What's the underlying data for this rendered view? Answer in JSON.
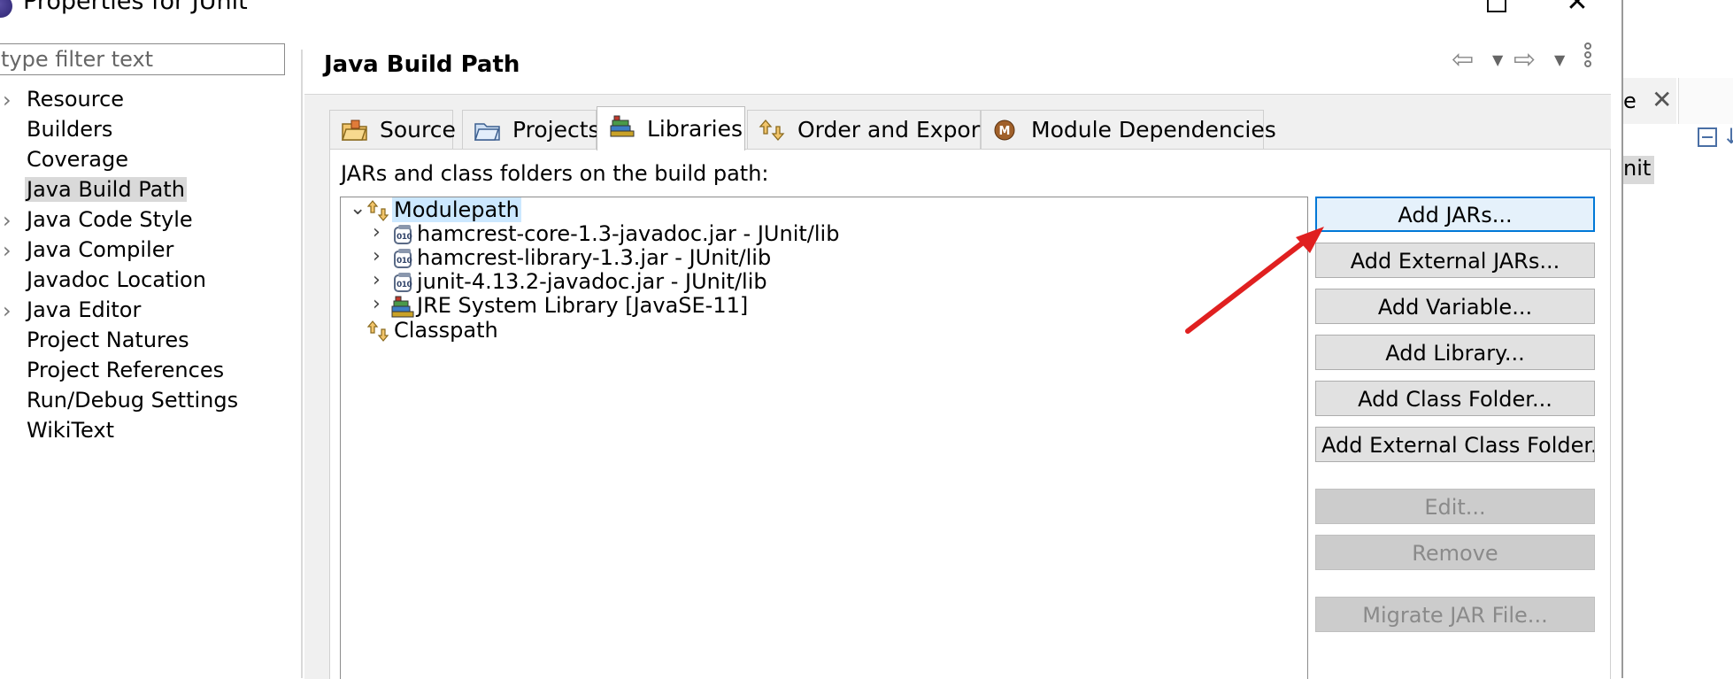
{
  "window": {
    "title": "Properties for JUnit",
    "minimize_label": "",
    "close_glyph": "✕"
  },
  "nav": {
    "filter_placeholder": "type filter text",
    "items": [
      {
        "label": "Resource",
        "expandable": true,
        "selected": false
      },
      {
        "label": "Builders",
        "expandable": false,
        "selected": false
      },
      {
        "label": "Coverage",
        "expandable": false,
        "selected": false
      },
      {
        "label": "Java Build Path",
        "expandable": false,
        "selected": true
      },
      {
        "label": "Java Code Style",
        "expandable": true,
        "selected": false
      },
      {
        "label": "Java Compiler",
        "expandable": true,
        "selected": false
      },
      {
        "label": "Javadoc Location",
        "expandable": false,
        "selected": false
      },
      {
        "label": "Java Editor",
        "expandable": true,
        "selected": false
      },
      {
        "label": "Project Natures",
        "expandable": false,
        "selected": false
      },
      {
        "label": "Project References",
        "expandable": false,
        "selected": false
      },
      {
        "label": "Run/Debug Settings",
        "expandable": false,
        "selected": false
      },
      {
        "label": "WikiText",
        "expandable": false,
        "selected": false
      }
    ]
  },
  "page": {
    "title": "Java Build Path",
    "header_icons": [
      "back-arrow-icon",
      "dropdown-icon",
      "forward-arrow-icon",
      "dropdown-icon",
      "more-vertical-icon"
    ]
  },
  "tabs": [
    {
      "label": "Source",
      "icon": "source-folder-icon",
      "active": false
    },
    {
      "label": "Projects",
      "icon": "projects-folder-icon",
      "active": false
    },
    {
      "label": "Libraries",
      "icon": "library-books-icon",
      "active": true
    },
    {
      "label": "Order and Export",
      "icon": "order-export-icon",
      "active": false
    },
    {
      "label": "Module Dependencies",
      "icon": "module-icon",
      "active": false
    }
  ],
  "libraries": {
    "label": "JARs and class folders on the build path:",
    "tree": {
      "modulepath": {
        "label": "Modulepath",
        "expanded": true,
        "selected": true,
        "children": [
          {
            "label": "hamcrest-core-1.3-javadoc.jar - JUnit/lib",
            "icon": "jar-icon"
          },
          {
            "label": "hamcrest-library-1.3.jar - JUnit/lib",
            "icon": "jar-icon"
          },
          {
            "label": "junit-4.13.2-javadoc.jar - JUnit/lib",
            "icon": "jar-icon"
          },
          {
            "label": "JRE System Library [JavaSE-11]",
            "icon": "library-books-icon"
          }
        ]
      },
      "classpath": {
        "label": "Classpath",
        "expanded": false
      }
    },
    "buttons": [
      {
        "label": "Add JARs...",
        "enabled": true,
        "focused": true
      },
      {
        "label": "Add External JARs...",
        "enabled": true
      },
      {
        "label": "Add Variable...",
        "enabled": true
      },
      {
        "label": "Add Library...",
        "enabled": true
      },
      {
        "label": "Add Class Folder...",
        "enabled": true
      },
      {
        "label": "Add External Class Folder...",
        "enabled": true
      },
      {
        "label": "Edit...",
        "enabled": false
      },
      {
        "label": "Remove",
        "enabled": false
      },
      {
        "label": "Migrate JAR File...",
        "enabled": false
      }
    ]
  },
  "annotation": {
    "color": "#e02020"
  },
  "background_window": {
    "tab_label_fragment": "e",
    "item_fragment": "nit"
  },
  "colors": {
    "selection": "#cce8ff",
    "nav_selection": "#d9d9d9",
    "focus_border": "#0078d7",
    "button_face": "#e1e1e1",
    "disabled_button": "#cccccc"
  }
}
